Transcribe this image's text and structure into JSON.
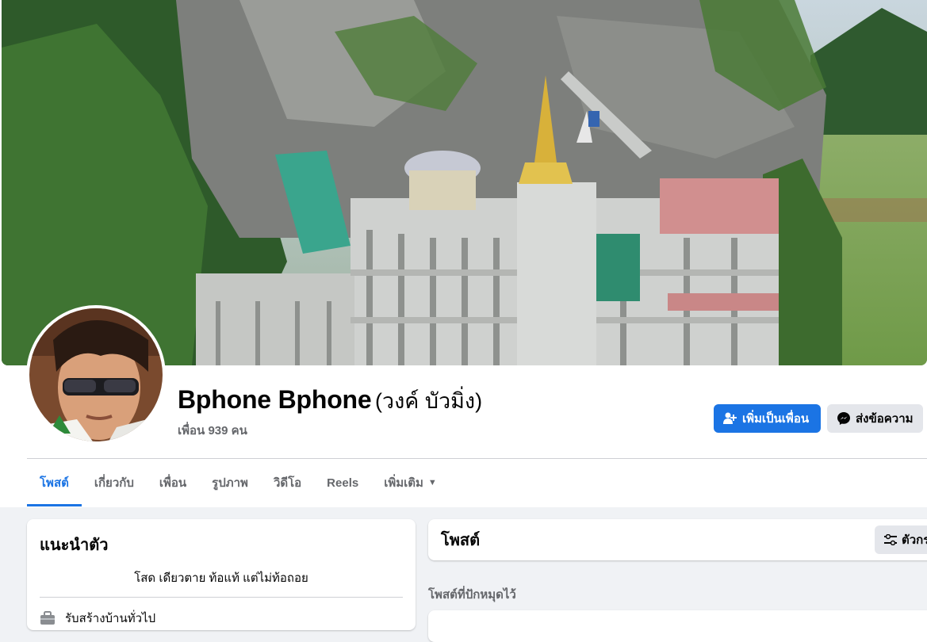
{
  "profile": {
    "name": "Bphone Bphone",
    "alternate_name": "(วงค์ บัวมิ่ง)",
    "friends": "เพื่อน 939 คน"
  },
  "actions": {
    "add_friend": "เพิ่มเป็นเพื่อน",
    "message": "ส่งข้อความ"
  },
  "tabs": [
    {
      "label": "โพสต์",
      "active": true
    },
    {
      "label": "เกี่ยวกับ"
    },
    {
      "label": "เพื่อน"
    },
    {
      "label": "รูปภาพ"
    },
    {
      "label": "วิดีโอ"
    },
    {
      "label": "Reels"
    },
    {
      "label": "เพิ่มเติม"
    }
  ],
  "intro": {
    "title": "แนะนำตัว",
    "bio": "โสด เดียวตาย ท้อแท้ แต่ไม่ท้อถอย",
    "work": "รับสร้างบ้านทั่วไป"
  },
  "posts": {
    "title": "โพสต์",
    "filter_label": "ตัวกรอง",
    "pinned_label": "โพสต์ที่ปักหมุดไว้"
  },
  "colors": {
    "primary": "#1b74e4",
    "secondary_button": "#e4e6eb",
    "page_background": "#f0f2f5",
    "muted_text": "#65676b"
  }
}
